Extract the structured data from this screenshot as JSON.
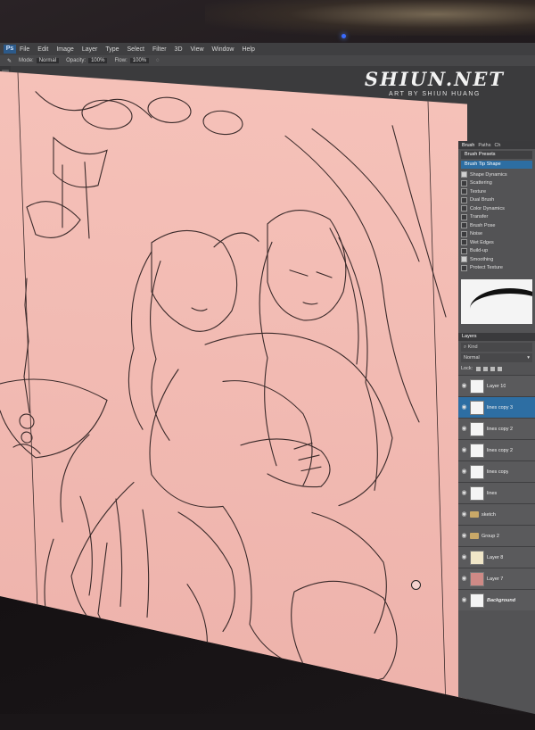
{
  "watermark": {
    "title": "SHIUN.NET",
    "subtitle": "ART BY SHIUN HUANG"
  },
  "menubar": {
    "logo": "Ps",
    "items": [
      "File",
      "Edit",
      "Image",
      "Layer",
      "Type",
      "Select",
      "Filter",
      "3D",
      "View",
      "Window",
      "Help"
    ]
  },
  "options_bar": {
    "mode_label": "Mode:",
    "mode_value": "Normal",
    "opacity_label": "Opacity:",
    "opacity_value": "100%",
    "flow_label": "Flow:",
    "flow_value": "100%"
  },
  "brush_panel": {
    "tabs": [
      "Brush",
      "Paths",
      "Ch"
    ],
    "presets_button": "Brush Presets",
    "header": "Brush Tip Shape",
    "options": [
      {
        "label": "Shape Dynamics",
        "checked": true
      },
      {
        "label": "Scattering",
        "checked": false
      },
      {
        "label": "Texture",
        "checked": false
      },
      {
        "label": "Dual Brush",
        "checked": false
      },
      {
        "label": "Color Dynamics",
        "checked": false
      },
      {
        "label": "Transfer",
        "checked": false
      },
      {
        "label": "Brush Pose",
        "checked": false
      },
      {
        "label": "Noise",
        "checked": false
      },
      {
        "label": "Wet Edges",
        "checked": false
      },
      {
        "label": "Build-up",
        "checked": false
      },
      {
        "label": "Smoothing",
        "checked": true
      },
      {
        "label": "Protect Texture",
        "checked": false
      }
    ]
  },
  "layers_panel": {
    "tab": "Layers",
    "filter": "Kind",
    "blend_mode": "Normal",
    "lock_label": "Lock:",
    "layers": [
      {
        "name": "Layer 10",
        "thumb": "white",
        "selected": false,
        "type": "layer"
      },
      {
        "name": "lines copy 3",
        "thumb": "white",
        "selected": true,
        "type": "layer"
      },
      {
        "name": "lines copy 2",
        "thumb": "white",
        "selected": false,
        "type": "layer"
      },
      {
        "name": "lines copy 2",
        "thumb": "white",
        "selected": false,
        "type": "layer"
      },
      {
        "name": "lines copy",
        "thumb": "white",
        "selected": false,
        "type": "layer"
      },
      {
        "name": "lines",
        "thumb": "white",
        "selected": false,
        "type": "layer"
      },
      {
        "name": "sketch",
        "thumb": "folder",
        "selected": false,
        "type": "group"
      },
      {
        "name": "Group 2",
        "thumb": "folder",
        "selected": false,
        "type": "group"
      },
      {
        "name": "Layer 8",
        "thumb": "cream",
        "selected": false,
        "type": "layer"
      },
      {
        "name": "Layer 7",
        "thumb": "pink",
        "selected": false,
        "type": "layer"
      },
      {
        "name": "Background",
        "thumb": "white",
        "selected": false,
        "type": "background"
      }
    ],
    "footer_icons": [
      "link-icon",
      "fx-icon",
      "mask-icon",
      "adjust-icon",
      "folder-icon",
      "new-layer-icon",
      "trash-icon"
    ]
  },
  "colors": {
    "canvas": "#f2b8b0",
    "selection": "#2d6ea3",
    "panel": "#535355",
    "ui_dark": "#3b3b3d"
  }
}
